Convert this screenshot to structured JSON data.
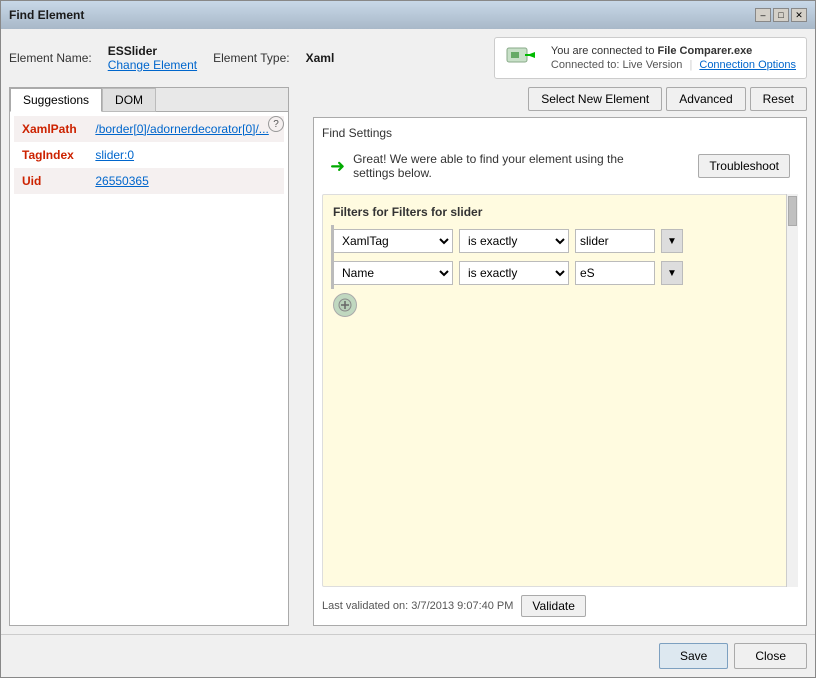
{
  "window": {
    "title": "Find Element",
    "controls": {
      "minimize": "–",
      "maximize": "□",
      "close": "✕"
    }
  },
  "header": {
    "element_name_label": "Element Name:",
    "element_name_value": "ESSlider",
    "change_element_label": "Change Element",
    "element_type_label": "Element Type:",
    "element_type_value": "Xaml"
  },
  "connection": {
    "title": "You are connected to",
    "app_name": "File Comparer.exe",
    "connected_to_label": "Connected to:",
    "connected_to_value": "Live Version",
    "options_label": "Connection Options"
  },
  "left_panel": {
    "tabs": [
      {
        "label": "Suggestions",
        "active": true
      },
      {
        "label": "DOM",
        "active": false
      }
    ],
    "suggestions": [
      {
        "key": "XamlPath",
        "value": "/border[0]/adornerdecorator[0]/..."
      },
      {
        "key": "TagIndex",
        "value": "slider:0"
      },
      {
        "key": "Uid",
        "value": "26550365"
      }
    ]
  },
  "right_panel": {
    "toolbar": {
      "select_new_element": "Select New Element",
      "advanced": "Advanced",
      "reset": "Reset"
    },
    "find_settings_label": "Find Settings",
    "success_message_1": "Great! We were able to find your element using the",
    "success_message_2": "settings below.",
    "troubleshoot_label": "Troubleshoot",
    "filters_title": "Filters for slider",
    "filters": [
      {
        "field": "XamlTag",
        "operator": "is exactly",
        "value": "slider"
      },
      {
        "field": "Name",
        "operator": "is exactly",
        "value": "eS"
      }
    ],
    "last_validated": "Last validated on: 3/7/2013 9:07:40 PM",
    "validate_label": "Validate"
  },
  "footer": {
    "save_label": "Save",
    "close_label": "Close"
  }
}
